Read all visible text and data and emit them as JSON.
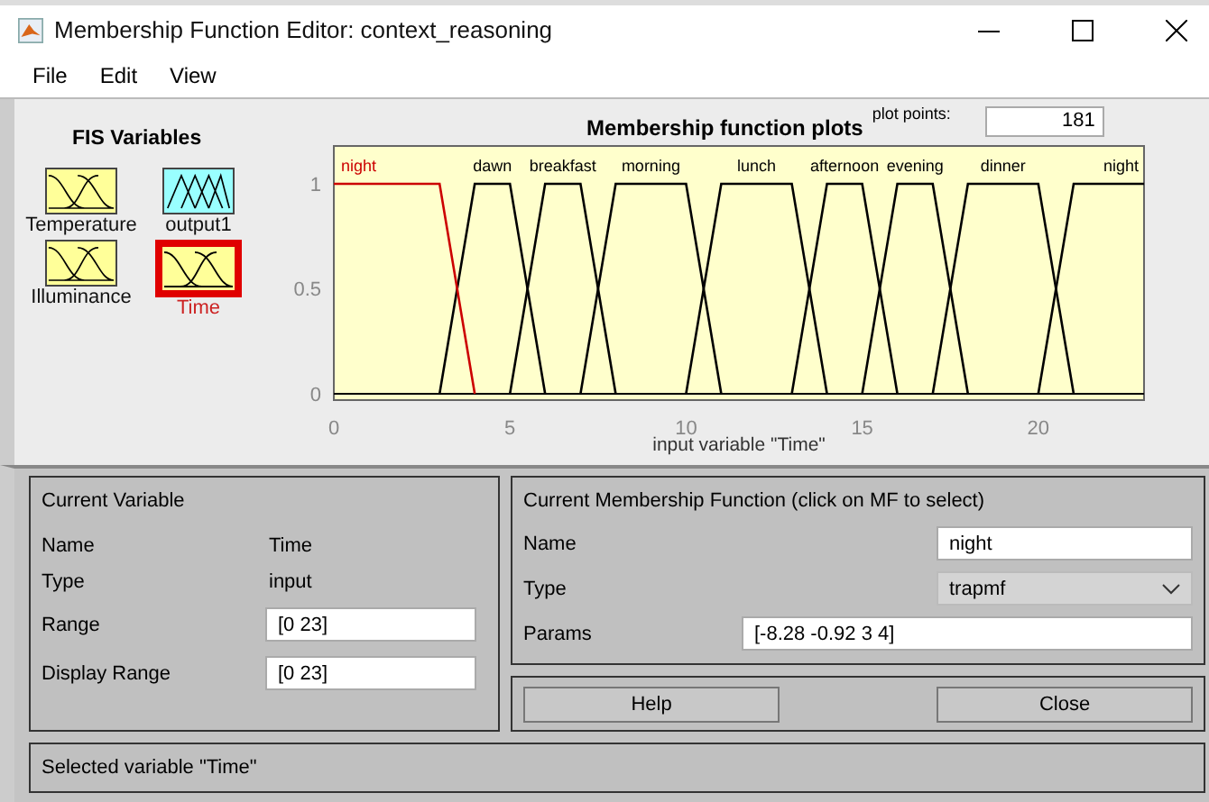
{
  "window": {
    "title": "Membership Function Editor: context_reasoning"
  },
  "menu": [
    "File",
    "Edit",
    "View"
  ],
  "fis_variables": {
    "title": "FIS Variables",
    "items": [
      {
        "name": "Temperature",
        "kind": "input",
        "selected": false
      },
      {
        "name": "output1",
        "kind": "output",
        "selected": false
      },
      {
        "name": "Illuminance",
        "kind": "input",
        "selected": false
      },
      {
        "name": "Time",
        "kind": "input",
        "selected": true
      }
    ]
  },
  "plot": {
    "title": "Membership function plots",
    "plot_points_label": "plot points:",
    "plot_points": "181",
    "chart_data": {
      "type": "line",
      "xlabel": "input variable \"Time\"",
      "x": [
        0,
        1,
        2,
        3,
        4,
        5,
        6,
        7,
        8,
        9,
        10,
        11,
        12,
        13,
        14,
        15,
        16,
        17,
        18,
        19,
        20,
        21,
        22,
        23
      ],
      "xlim": [
        0,
        23
      ],
      "ylim": [
        -0.03,
        1.18
      ],
      "xticks": [
        0,
        5,
        10,
        15,
        20
      ],
      "yticks": [
        0,
        0.5,
        1
      ],
      "series": [
        {
          "name": "night",
          "color": "#cc0000",
          "values": [
            1,
            1,
            1,
            1,
            0,
            null,
            null,
            null,
            null,
            null,
            null,
            null,
            null,
            null,
            null,
            null,
            null,
            null,
            null,
            null,
            null,
            null,
            null,
            null
          ]
        },
        {
          "name": "dawn",
          "color": "#000000",
          "values": [
            null,
            null,
            null,
            0,
            1,
            1,
            0,
            null,
            null,
            null,
            null,
            null,
            null,
            null,
            null,
            null,
            null,
            null,
            null,
            null,
            null,
            null,
            null,
            null
          ]
        },
        {
          "name": "breakfast",
          "color": "#000000",
          "values": [
            null,
            null,
            null,
            null,
            null,
            0,
            1,
            1,
            0,
            null,
            null,
            null,
            null,
            null,
            null,
            null,
            null,
            null,
            null,
            null,
            null,
            null,
            null,
            null
          ]
        },
        {
          "name": "morning",
          "color": "#000000",
          "values": [
            null,
            null,
            null,
            null,
            null,
            null,
            null,
            0,
            1,
            1,
            1,
            0,
            null,
            null,
            null,
            null,
            null,
            null,
            null,
            null,
            null,
            null,
            null,
            null
          ]
        },
        {
          "name": "lunch",
          "color": "#000000",
          "values": [
            null,
            null,
            null,
            null,
            null,
            null,
            null,
            null,
            null,
            null,
            0,
            1,
            1,
            1,
            0,
            null,
            null,
            null,
            null,
            null,
            null,
            null,
            null,
            null
          ]
        },
        {
          "name": "afternoon",
          "color": "#000000",
          "values": [
            null,
            null,
            null,
            null,
            null,
            null,
            null,
            null,
            null,
            null,
            null,
            null,
            null,
            0,
            1,
            1,
            0,
            null,
            null,
            null,
            null,
            null,
            null,
            null
          ]
        },
        {
          "name": "evening",
          "color": "#000000",
          "values": [
            null,
            null,
            null,
            null,
            null,
            null,
            null,
            null,
            null,
            null,
            null,
            null,
            null,
            null,
            null,
            0,
            1,
            1,
            0,
            null,
            null,
            null,
            null,
            null
          ]
        },
        {
          "name": "dinner",
          "color": "#000000",
          "values": [
            null,
            null,
            null,
            null,
            null,
            null,
            null,
            null,
            null,
            null,
            null,
            null,
            null,
            null,
            null,
            null,
            null,
            0,
            1,
            1,
            1,
            0,
            null,
            null
          ]
        },
        {
          "name": "night",
          "color": "#000000",
          "values": [
            null,
            null,
            null,
            null,
            null,
            null,
            null,
            null,
            null,
            null,
            null,
            null,
            null,
            null,
            null,
            null,
            null,
            null,
            null,
            null,
            0,
            1,
            1,
            1
          ]
        }
      ]
    }
  },
  "current_variable": {
    "title": "Current Variable",
    "fields": [
      {
        "label": "Name",
        "value": "Time",
        "kind": "text"
      },
      {
        "label": "Type",
        "value": "input",
        "kind": "text"
      },
      {
        "label": "Range",
        "value": "[0 23]",
        "kind": "input"
      },
      {
        "label": "Display Range",
        "value": "[0 23]",
        "kind": "input"
      }
    ]
  },
  "current_mf": {
    "title": "Current Membership Function (click on MF to select)",
    "name_label": "Name",
    "name": "night",
    "type_label": "Type",
    "type": "trapmf",
    "params_label": "Params",
    "params": "[-8.28 -0.92 3 4]"
  },
  "buttons": [
    "Help",
    "Close"
  ],
  "status_bar": "Selected variable \"Time\""
}
